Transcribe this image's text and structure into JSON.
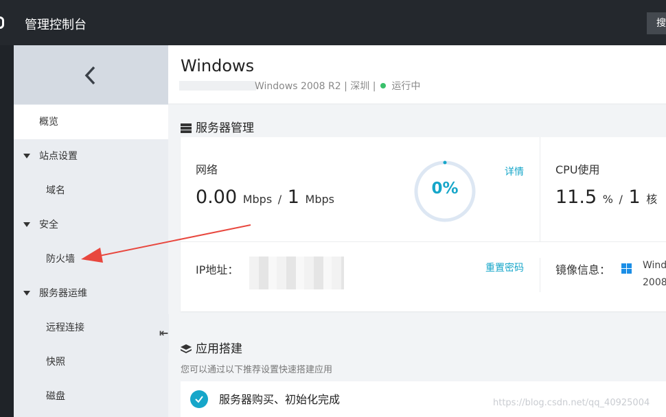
{
  "topbar": {
    "title": "管理控制台",
    "search_label": "搜"
  },
  "sidebar": {
    "items": [
      {
        "label": "概览"
      },
      {
        "label": "站点设置"
      },
      {
        "label": "域名"
      },
      {
        "label": "安全"
      },
      {
        "label": "防火墙"
      },
      {
        "label": "服务器运维"
      },
      {
        "label": "远程连接"
      },
      {
        "label": "快照"
      },
      {
        "label": "磁盘"
      }
    ]
  },
  "header": {
    "name": "Windows",
    "meta": "Windows 2008 R2 | 深圳 |",
    "status": "运行中"
  },
  "server_mgmt": {
    "title": "服务器管理",
    "network": {
      "label": "网络",
      "used": "0.00",
      "used_unit": "Mbps",
      "sep": "/",
      "total": "1",
      "total_unit": "Mbps",
      "percent_text": "0%",
      "percent": 0,
      "details_link": "详情"
    },
    "cpu": {
      "label": "CPU使用",
      "used": "11.5",
      "used_unit": "%",
      "sep": "/",
      "total": "1",
      "total_unit": "核"
    },
    "ip": {
      "label": "IP地址：",
      "reset_link": "重置密码"
    },
    "image": {
      "label": "镜像信息：",
      "line1": "Wind",
      "line2": "2008"
    }
  },
  "app_build": {
    "title": "应用搭建",
    "description": "您可以通过以下推荐设置快速搭建应用",
    "step1": "服务器购买、初始化完成"
  },
  "watermark": "https://blog.csdn.net/qq_40925004",
  "colors": {
    "accent": "#16a6c9",
    "status_green": "#39c06b",
    "annotation_arrow": "#e8473e"
  }
}
